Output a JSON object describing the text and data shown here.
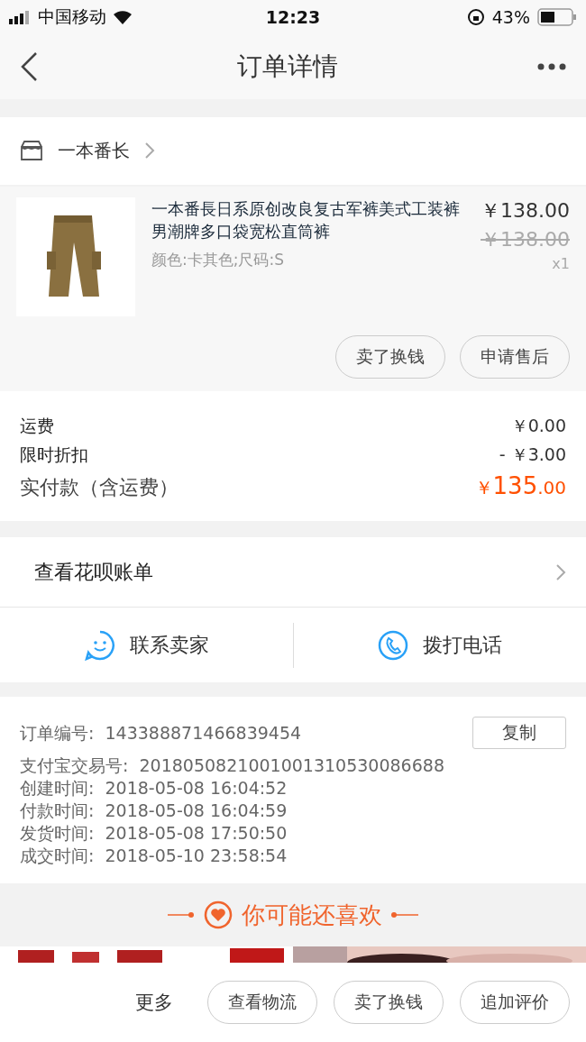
{
  "status_bar": {
    "carrier": "中国移动",
    "time": "12:23",
    "battery": "43%"
  },
  "nav": {
    "title": "订单详情"
  },
  "store": {
    "name": "一本番长"
  },
  "product": {
    "title": "一本番長日系原创改良复古军裤美式工装裤男潮牌多口袋宽松直筒裤",
    "sku": "颜色:卡其色;尺码:S",
    "price": "￥138.00",
    "original_price": "￥138.00",
    "quantity": "x1",
    "actions": [
      "卖了换钱",
      "申请售后"
    ]
  },
  "fees": [
    {
      "label": "运费",
      "value": "￥0.00",
      "kind": "normal"
    },
    {
      "label": "限时折扣",
      "value": "- ￥3.00",
      "kind": "normal"
    },
    {
      "label": "实付款（含运费）",
      "value": "135",
      "value_prefix": "￥",
      "value_suffix": ".00",
      "kind": "total"
    }
  ],
  "huabei": {
    "label": "查看花呗账单"
  },
  "contact": [
    {
      "label": "联系卖家",
      "kind": "chat"
    },
    {
      "label": "拨打电话",
      "kind": "phone"
    }
  ],
  "order_info": {
    "rows": [
      {
        "label": "订单编号:",
        "value": "143388871466839454"
      },
      {
        "label": "支付宝交易号:",
        "value": "2018050821001001310530086688"
      },
      {
        "label": "创建时间:",
        "value": "2018-05-08 16:04:52"
      },
      {
        "label": "付款时间:",
        "value": "2018-05-08 16:04:59"
      },
      {
        "label": "发货时间:",
        "value": "2018-05-08 17:50:50"
      },
      {
        "label": "成交时间:",
        "value": "2018-05-10 23:58:54"
      }
    ],
    "copy_button": "复制"
  },
  "recommend": {
    "title": "你可能还喜欢"
  },
  "bottom_bar": {
    "more": "更多",
    "buttons": [
      "查看物流",
      "卖了换钱",
      "追加评价"
    ]
  }
}
